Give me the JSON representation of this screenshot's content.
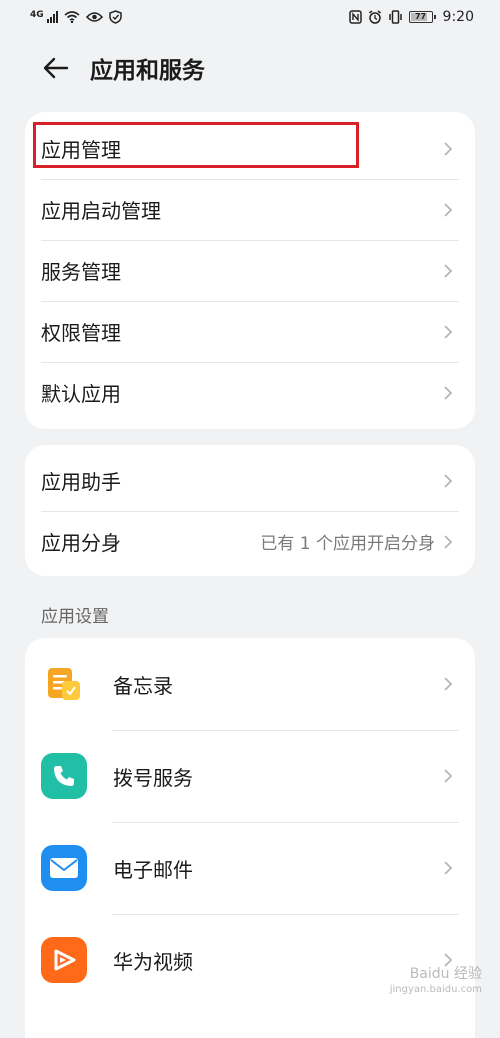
{
  "status_bar": {
    "network": "4G",
    "battery": "77",
    "time": "9:20"
  },
  "header": {
    "title": "应用和服务"
  },
  "group1": {
    "items": [
      {
        "label": "应用管理"
      },
      {
        "label": "应用启动管理"
      },
      {
        "label": "服务管理"
      },
      {
        "label": "权限管理"
      },
      {
        "label": "默认应用"
      }
    ]
  },
  "group2": {
    "items": [
      {
        "label": "应用助手",
        "value": ""
      },
      {
        "label": "应用分身",
        "value": "已有 1 个应用开启分身"
      }
    ]
  },
  "app_settings": {
    "section_title": "应用设置",
    "apps": [
      {
        "label": "备忘录",
        "icon": "notepad-icon",
        "color": "#f6a623"
      },
      {
        "label": "拨号服务",
        "icon": "phone-icon",
        "color": "#21bfa6"
      },
      {
        "label": "电子邮件",
        "icon": "mail-icon",
        "color": "#1e8ef0"
      },
      {
        "label": "华为视频",
        "icon": "video-play-icon",
        "color": "#ff6a1a"
      }
    ]
  },
  "watermark": {
    "text": "Baidu 经验",
    "sub": "jingyan.baidu.com"
  },
  "colors": {
    "highlight": "#d8202a",
    "background": "#f1f2f4"
  }
}
